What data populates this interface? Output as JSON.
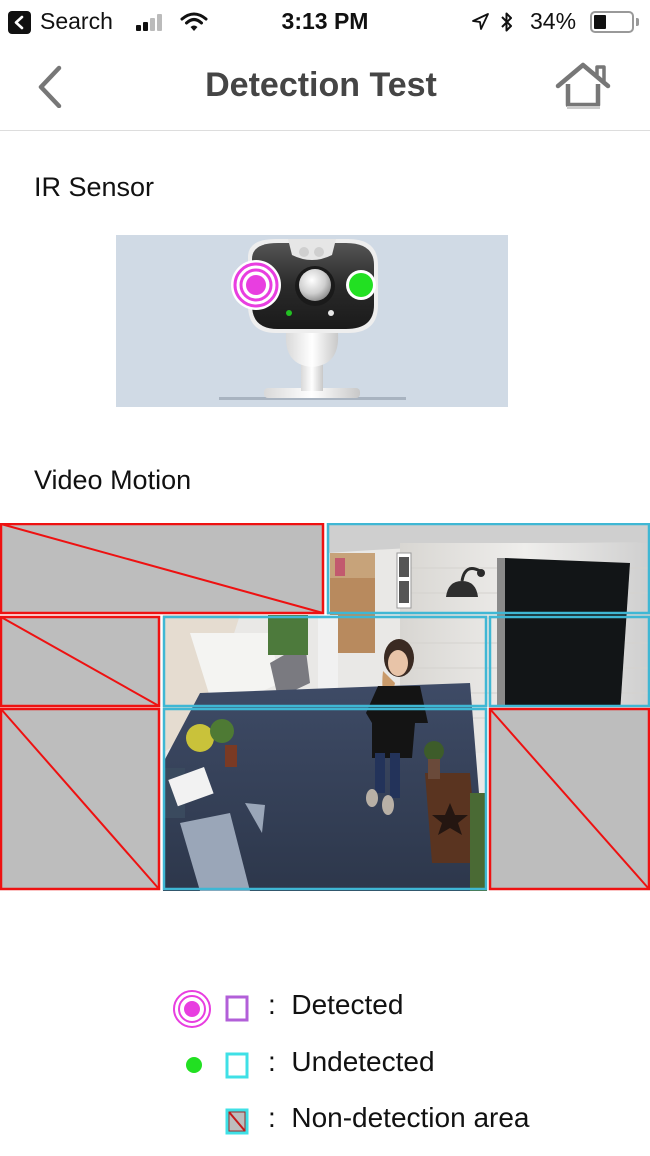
{
  "status_bar": {
    "back_app_label": "Search",
    "time": "3:13 PM",
    "battery_percent": "34%",
    "battery_level": 0.34,
    "signal_bars_active": 2,
    "signal_bars_total": 4,
    "icons": [
      "back-to-app-icon",
      "cellular-signal-icon",
      "wifi-icon",
      "location-arrow-icon",
      "bluetooth-icon",
      "battery-icon"
    ]
  },
  "nav": {
    "title": "Detection Test",
    "back_icon": "chevron-left-icon",
    "home_icon": "home-icon"
  },
  "ir_sensor": {
    "label": "IR Sensor",
    "sensors": [
      {
        "position": "left",
        "state": "detected"
      },
      {
        "position": "right",
        "state": "undetected"
      }
    ]
  },
  "video_motion": {
    "label": "Video Motion",
    "zones": [
      {
        "id": "top-left",
        "state": "non-detection"
      },
      {
        "id": "top-right",
        "state": "undetected"
      },
      {
        "id": "middle-left",
        "state": "non-detection"
      },
      {
        "id": "middle-center",
        "state": "undetected"
      },
      {
        "id": "middle-right",
        "state": "undetected"
      },
      {
        "id": "bottom-left",
        "state": "non-detection"
      },
      {
        "id": "bottom-center",
        "state": "undetected"
      },
      {
        "id": "bottom-right",
        "state": "non-detection"
      }
    ]
  },
  "legend": {
    "separator": ":",
    "items": [
      {
        "key": "detected",
        "label": "Detected"
      },
      {
        "key": "undetected",
        "label": "Undetected"
      },
      {
        "key": "non-detection",
        "label": "Non-detection area"
      }
    ]
  },
  "colors": {
    "detected": "#e83ee0",
    "undetected_zone": "#3fb7d4",
    "undetected_ir": "#22e022",
    "non_detection_border": "#ee1111",
    "non_detection_fill": "#bdbdbd",
    "ir_panel_bg": "#d0dae5",
    "title_text": "#454545"
  }
}
